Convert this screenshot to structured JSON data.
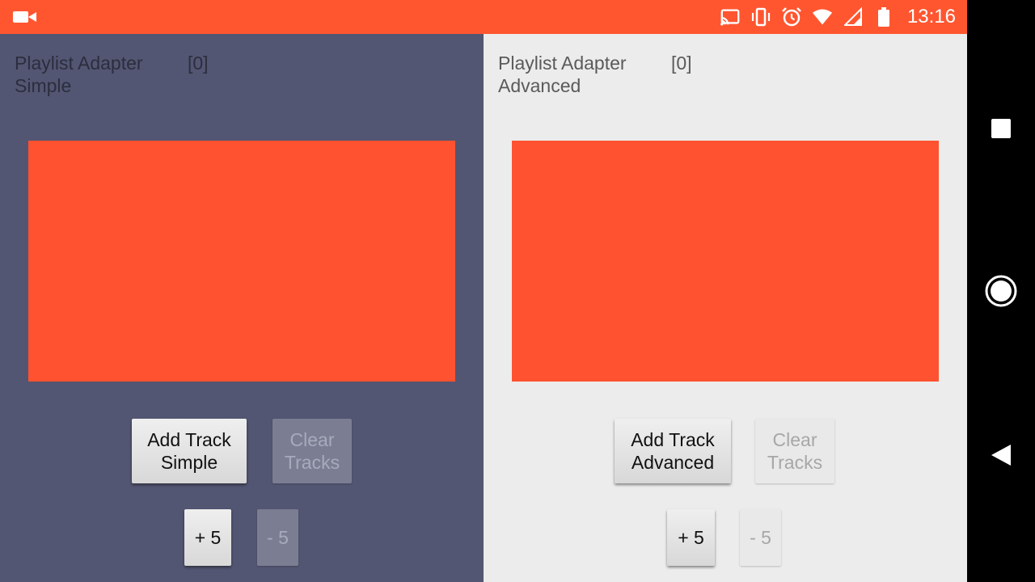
{
  "status_bar": {
    "time": "13:16",
    "icons": [
      "video-camera-icon",
      "cast-icon",
      "vibrate-icon",
      "alarm-icon",
      "wifi-icon",
      "signal-icon",
      "battery-icon"
    ],
    "color": "#ff5630"
  },
  "nav_bar": {
    "buttons": [
      "recents-button",
      "home-button",
      "back-button"
    ]
  },
  "left_panel": {
    "title": "Playlist Adapter\n Simple",
    "count": "[0]",
    "background": "#535672",
    "add_button": "Add Track\nSimple",
    "clear_button": "Clear\nTracks",
    "plus_button": "+ 5",
    "minus_button": "- 5"
  },
  "right_panel": {
    "title": "Playlist Adapter\nAdvanced",
    "count": "[0]",
    "background": "#ececec",
    "add_button": "Add Track\nAdvanced",
    "clear_button": "Clear\nTracks",
    "plus_button": "+ 5",
    "minus_button": "- 5"
  },
  "player_color": "#ff5230"
}
